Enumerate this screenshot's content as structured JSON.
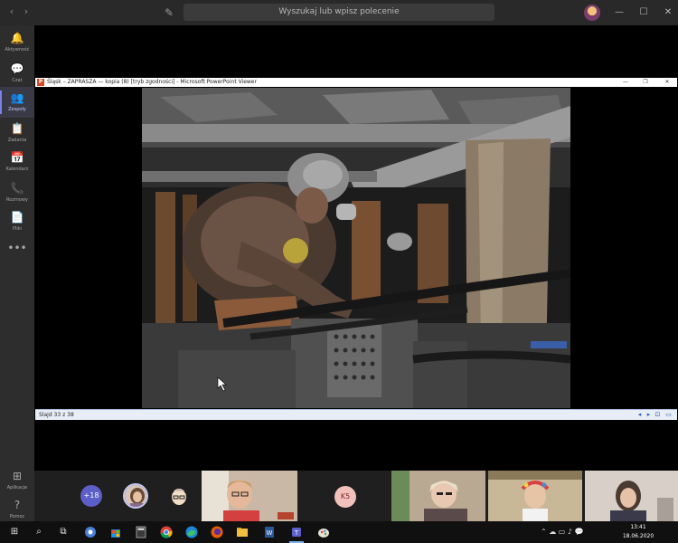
{
  "topbar": {
    "search_placeholder": "Wyszukaj lub wpisz polecenie",
    "back_icon": "‹",
    "forward_icon": "›",
    "compose_icon": "✎",
    "minimize_icon": "—",
    "maximize_icon": "☐",
    "close_icon": "✕"
  },
  "rail": {
    "items": [
      {
        "label": "Aktywność",
        "icon": "🔔"
      },
      {
        "label": "Czat",
        "icon": "💬"
      },
      {
        "label": "Zespoły",
        "icon": "👥"
      },
      {
        "label": "Zadania",
        "icon": "📋"
      },
      {
        "label": "Kalendarz",
        "icon": "📅"
      },
      {
        "label": "Rozmowy",
        "icon": "📞"
      },
      {
        "label": "Pliki",
        "icon": "📄"
      },
      {
        "label": "",
        "icon": "•••"
      },
      {
        "label": "Aplikacje",
        "icon": "⊞"
      },
      {
        "label": "Pomoc",
        "icon": "?"
      }
    ],
    "active_index": 2
  },
  "ppt": {
    "logo": "P",
    "title": "Śląsk – ZAPRASZA — kopia (8) [tryb zgodności] - Microsoft PowerPoint Viewer",
    "minimize": "—",
    "restore": "❐",
    "close": "✕",
    "status": "Slajd 33 z 38",
    "prev_icon": "◂",
    "next_icon": "▸",
    "fit_icon": "⊡",
    "slideshow_icon": "▭"
  },
  "participants": {
    "more_count": "+18",
    "initials": "K5"
  },
  "taskbar": {
    "start_icon": "⊞",
    "search_icon": "⌕",
    "taskview_icon": "⧉",
    "time": "13:41",
    "date": "18.06.2020",
    "tray_icons": "⌃ ☁ ▭ ♪ 💬"
  },
  "colors": {
    "accent": "#7b83eb",
    "ppt_red": "#d24726"
  }
}
